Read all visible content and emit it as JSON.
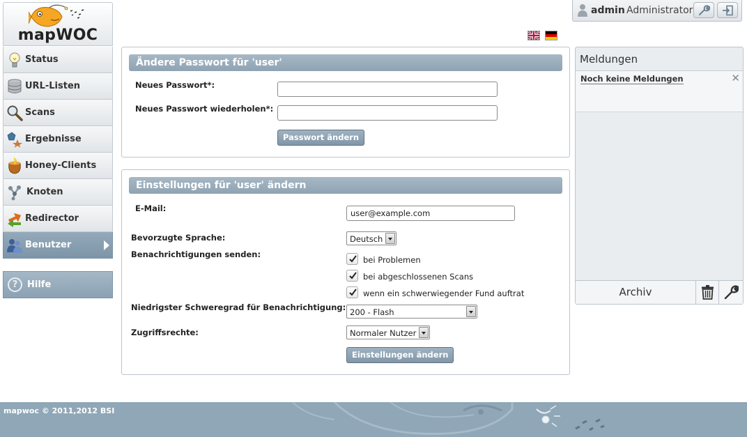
{
  "user": {
    "name": "admin",
    "role": "Administrator"
  },
  "app": {
    "logo_text": "mapWOC"
  },
  "nav": {
    "items": [
      {
        "label": "Status",
        "icon": "lightbulb-icon"
      },
      {
        "label": "URL-Listen",
        "icon": "database-icon"
      },
      {
        "label": "Scans",
        "icon": "magnifier-icon"
      },
      {
        "label": "Ergebnisse",
        "icon": "results-icon"
      },
      {
        "label": "Honey-Clients",
        "icon": "honeypot-icon"
      },
      {
        "label": "Knoten",
        "icon": "nodes-icon"
      },
      {
        "label": "Redirector",
        "icon": "redirect-arrows-icon"
      },
      {
        "label": "Benutzer",
        "icon": "users-icon",
        "active": true
      }
    ],
    "help_label": "Hilfe"
  },
  "languages": [
    "english-flag",
    "german-flag"
  ],
  "password_panel": {
    "title": "Ändere Passwort für 'user'",
    "new_password_label": "Neues Passwort*:",
    "repeat_password_label": "Neues Passwort wiederholen*:",
    "new_password_value": "",
    "repeat_password_value": "",
    "submit_label": "Passwort ändern"
  },
  "settings_panel": {
    "title": "Einstellungen für 'user' ändern",
    "email_label": "E-Mail:",
    "email_value": "user@example.com",
    "language_label": "Bevorzugte Sprache:",
    "language_value": "Deutsch",
    "notifications_label": "Benachrichtigungen senden:",
    "notify_options": [
      {
        "label": "bei Problemen",
        "checked": true
      },
      {
        "label": "bei abgeschlossenen Scans",
        "checked": true
      },
      {
        "label": "wenn ein schwerwiegender Fund auftrat",
        "checked": true
      }
    ],
    "severity_label": "Niedrigster Schweregrad für Benachrichtigung:",
    "severity_value": "200 - Flash",
    "access_label": "Zugriffsrechte:",
    "access_value": "Normaler Nutzer",
    "submit_label": "Einstellungen ändern"
  },
  "messages": {
    "title": "Meldungen",
    "empty_text": "Noch keine Meldungen",
    "archive_label": "Archiv"
  },
  "footer": {
    "text": "mapwoc © 2011,2012 BSI"
  },
  "colors": {
    "accent": "#8ea3b3",
    "active_nav": "#7d95a8",
    "footer": "#8fa7b7"
  }
}
